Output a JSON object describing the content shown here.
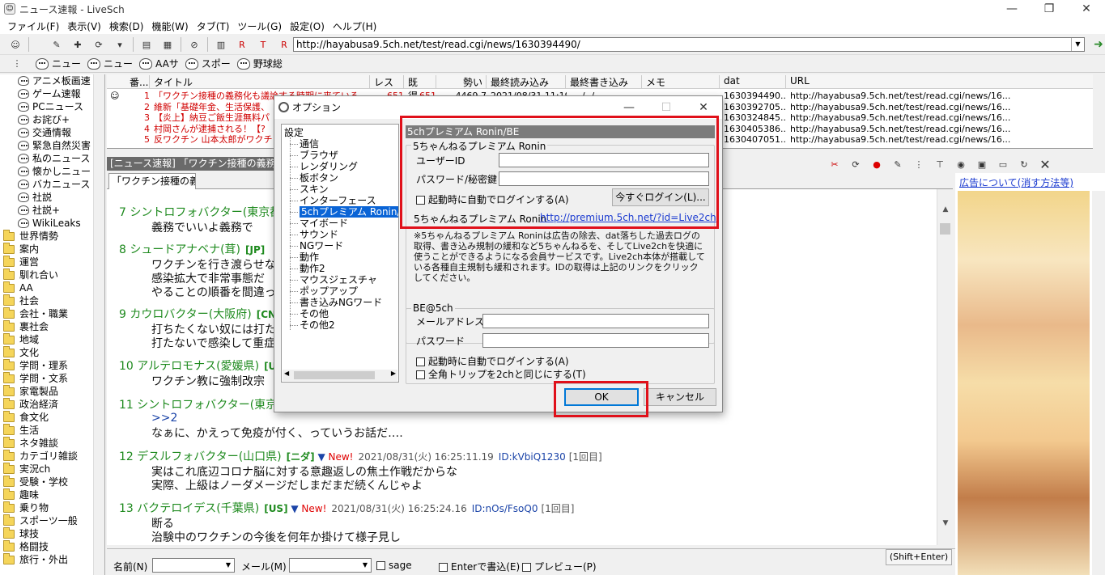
{
  "window": {
    "title": "ニュース速報 - LiveSch"
  },
  "menu": [
    "ファイル(F)",
    "表示(V)",
    "検索(D)",
    "機能(W)",
    "タブ(T)",
    "ツール(G)",
    "設定(O)",
    "ヘルプ(H)"
  ],
  "url": "http://hayabusa9.5ch.net/test/read.cgi/news/1630394490/",
  "favorites": [
    "ニュー",
    "ニュー",
    "AAサ",
    "スポー",
    "野球総"
  ],
  "tree": [
    {
      "label": "アニメ板画速",
      "icon": "face"
    },
    {
      "label": "ゲーム速報",
      "icon": "face"
    },
    {
      "label": "PCニュース",
      "icon": "face"
    },
    {
      "label": "お詫び+",
      "icon": "face"
    },
    {
      "label": "交通情報",
      "icon": "face"
    },
    {
      "label": "緊急自然災害",
      "icon": "face"
    },
    {
      "label": "私のニュース",
      "icon": "face"
    },
    {
      "label": "懐かしニュー",
      "icon": "face"
    },
    {
      "label": "バカニュース",
      "icon": "face"
    },
    {
      "label": "社説",
      "icon": "face"
    },
    {
      "label": "社説+",
      "icon": "face"
    },
    {
      "label": "WikiLeaks",
      "icon": "face"
    },
    {
      "label": "世界情勢",
      "icon": "folder"
    },
    {
      "label": "案内",
      "icon": "folder"
    },
    {
      "label": "運営",
      "icon": "folder"
    },
    {
      "label": "馴れ合い",
      "icon": "folder"
    },
    {
      "label": "AA",
      "icon": "folder"
    },
    {
      "label": "社会",
      "icon": "folder"
    },
    {
      "label": "会社・職業",
      "icon": "folder"
    },
    {
      "label": "裏社会",
      "icon": "folder"
    },
    {
      "label": "地域",
      "icon": "folder"
    },
    {
      "label": "文化",
      "icon": "folder"
    },
    {
      "label": "学問・理系",
      "icon": "folder"
    },
    {
      "label": "学問・文系",
      "icon": "folder"
    },
    {
      "label": "家電製品",
      "icon": "folder"
    },
    {
      "label": "政治経済",
      "icon": "folder"
    },
    {
      "label": "食文化",
      "icon": "folder"
    },
    {
      "label": "生活",
      "icon": "folder"
    },
    {
      "label": "ネタ雑談",
      "icon": "folder"
    },
    {
      "label": "カテゴリ雑談",
      "icon": "folder"
    },
    {
      "label": "実況ch",
      "icon": "folder"
    },
    {
      "label": "受験・学校",
      "icon": "folder"
    },
    {
      "label": "趣味",
      "icon": "folder"
    },
    {
      "label": "乗り物",
      "icon": "folder"
    },
    {
      "label": "スポーツ一般",
      "icon": "folder"
    },
    {
      "label": "球技",
      "icon": "folder"
    },
    {
      "label": "格闘技",
      "icon": "folder"
    },
    {
      "label": "旅行・外出",
      "icon": "folder"
    }
  ],
  "threadlist": {
    "columns": [
      "番...",
      "タイトル",
      "レス",
      "既得...",
      "勢い",
      "最終読み込み",
      "最終書き込み",
      "メモ",
      "dat",
      "URL"
    ],
    "rows": [
      {
        "no": "1",
        "title": "「ワクチン接種の義務化も議論する時期に来ている",
        "res": "651",
        "got": "651",
        "power": "4469.7",
        "read": "2021/08/31 11:19",
        "write": "----/--/-- --",
        "dat": "1630394490...",
        "url": "http://hayabusa9.5ch.net/test/read.cgi/news/16..."
      },
      {
        "no": "2",
        "title": "維新「基礎年金、生活保護、",
        "dat": "1630392705...",
        "url": "http://hayabusa9.5ch.net/test/read.cgi/news/16..."
      },
      {
        "no": "3",
        "title": "【炎上】納豆ご飯生涯無料パ",
        "dat": "1630324845...",
        "url": "http://hayabusa9.5ch.net/test/read.cgi/news/16..."
      },
      {
        "no": "4",
        "title": "村岡さんが逮捕される！【?",
        "dat": "1630405386...",
        "url": "http://hayabusa9.5ch.net/test/read.cgi/news/16..."
      },
      {
        "no": "5",
        "title": "反ワクチン 山本太郎がワクチ",
        "dat": "1630407051...",
        "url": "http://hayabusa9.5ch.net/test/read.cgi/news/16..."
      }
    ]
  },
  "thread_title": "[ニュース速報] 「ワクチン接種の義務化も",
  "tab_label": "「ワクチン接種の義",
  "posts": [
    {
      "header": "7 シントロフォバクター(東京都",
      "lines": [
        "義務でいいよ義務で"
      ]
    },
    {
      "header": "8 シュードアナベナ(茸)",
      "cc": "[JP]",
      "lines": [
        "ワクチンを行き渡らせな",
        "感染拡大で非常事態だ",
        "やることの順番を間違っ"
      ]
    },
    {
      "header": "9 カウロバクター(大阪府)",
      "cc": "[CN]",
      "lines": [
        "打ちたくない奴には打た",
        "打たないで感染して重症"
      ]
    },
    {
      "header": "10 アルテロモナス(愛媛県)",
      "cc": "[US]",
      "lines": [
        "ワクチン教に強制改宗"
      ]
    },
    {
      "header": "11 シントロフォバクター(東京",
      "ref": ">>2",
      "lines": [
        "なぁに、かえって免疫が付く、っていうお話だ‥‥"
      ]
    },
    {
      "header": "12 デスルフォバクター(山口県)",
      "cc": "[ニダ]",
      "new": "New!",
      "meta": "2021/08/31(火) 16:25:11.19",
      "id": "ID:kVbiQ1230",
      "count": "[1回目]",
      "lines": [
        "実はこれ底辺コロナ脳に対する意趣返しの焦土作戦だからな",
        "実際、上級はノーダメージだしまだまだ続くんじゃよ"
      ]
    },
    {
      "header": "13 バクテロイデス(千葉県)",
      "cc": "[US]",
      "new": "New!",
      "meta": "2021/08/31(火) 16:25:24.16",
      "id": "ID:nOs/FsoQ0",
      "count": "[1回目]",
      "lines": [
        "断る",
        "治験中のワクチンの今後を何年か掛けて様子見し"
      ]
    }
  ],
  "ad": {
    "link": "広告について(消す方法等)"
  },
  "bottom": {
    "name_label": "名前(N)",
    "mail_label": "メール(M)",
    "sage": "sage",
    "enter": "Enterで書込(E)",
    "preview": "プレビュー(P)",
    "shift": "(Shift+Enter)"
  },
  "dialog": {
    "title": "オプション",
    "nav_root": "設定",
    "nav_items": [
      "通信",
      "ブラウザ",
      "レンダリング",
      "板ボタン",
      "スキン",
      "インターフェース",
      "5chプレミアム Ronin/BE",
      "マイボード",
      "サウンド",
      "NGワード",
      "動作",
      "動作2",
      "マウスジェスチャ",
      "ポップアップ",
      "書き込みNGワード",
      "その他",
      "その他2"
    ],
    "page_title": "5chプレミアム Ronin/BE",
    "ronin": {
      "group": "5ちゃんねるプレミアム Ronin",
      "user_label": "ユーザーID",
      "user_value": "",
      "pass_label": "パスワード/秘密鍵",
      "pass_value": "",
      "auto_login": "起動時に自動でログインする(A)",
      "login_now": "今すぐログイン(L)...",
      "site_label": "5ちゃんねるプレミアム Ronin",
      "site_link": "http://premium.5ch.net/?id=Live2ch",
      "desc": [
        "※5ちゃんねるプレミアム Roninは広告の除去、dat落ちした過去ログの",
        "取得、書き込み規制の緩和など5ちゃんねるを、そしてLive2chを快適に",
        "使うことができるようになる会員サービスです。Live2ch本体が搭載して",
        "いる各種自主規制も緩和されます。IDの取得は上記のリンクをクリック",
        "してください。"
      ]
    },
    "be": {
      "group": "BE@5ch",
      "mail_label": "メールアドレス",
      "pass_label": "パスワード",
      "auto_login": "起動時に自動でログインする(A)",
      "trip": "全角トリップを2chと同じにする(T)"
    },
    "ok": "OK",
    "cancel": "キャンセル"
  }
}
